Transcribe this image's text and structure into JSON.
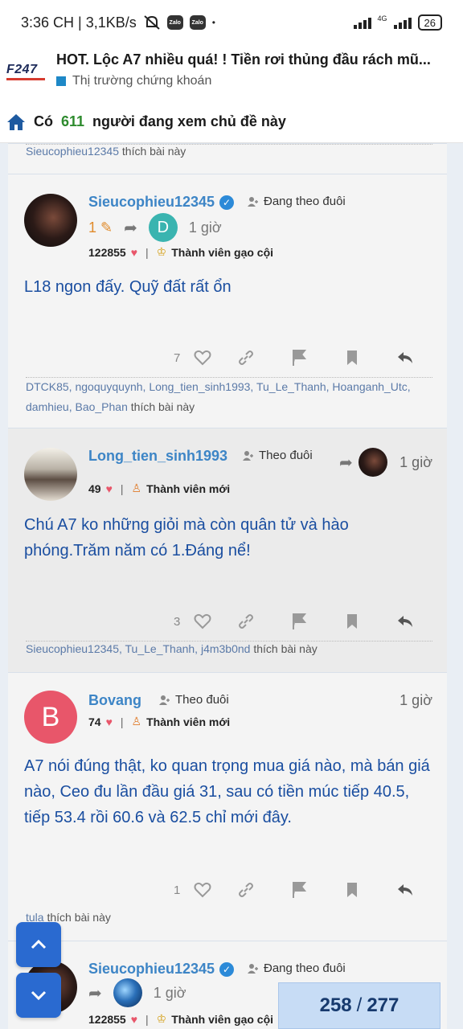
{
  "status": {
    "time": "3:36 CH | 3,1KB/s",
    "zalo1": "Zalo",
    "zalo2": "Zalo",
    "dot": "•",
    "network": "4G",
    "battery": "26"
  },
  "header": {
    "logo": "F247",
    "title": "HOT. Lộc A7 nhiều quá! ! Tiền rơi thủng đầu rách mũ...",
    "category": "Thị trường chứng khoán",
    "category_color": "#1e88c7"
  },
  "viewers": {
    "prefix": "Có",
    "count": "611",
    "suffix": "người đang xem chủ đề này"
  },
  "posts": [
    {
      "liked_names_top": "Sieucophieu12345",
      "liked_suffix_top": "thích bài này",
      "username": "Sieucophieu12345",
      "follow": "Đang theo đuôi",
      "edits": "1",
      "reply_avatar": "D",
      "time": "1 giờ",
      "points": "122855",
      "rank": "Thành viên gạo cội",
      "content": "L18 ngon đấy. Quỹ đất rất ổn",
      "likes": "7",
      "liked_names": "DTCK85, ngoquyquynh, Long_tien_sinh1993, Tu_Le_Thanh, Hoanganh_Utc, damhieu, Bao_Phan",
      "liked_suffix": "thích bài này"
    },
    {
      "username": "Long_tien_sinh1993",
      "follow": "Theo đuôi",
      "time": "1 giờ",
      "points": "49",
      "rank": "Thành viên mới",
      "content": "Chú A7 ko những giỏi mà còn quân tử và hào phóng.Trăm năm có 1.Đáng nể!",
      "likes": "3",
      "liked_names": "Sieucophieu12345, Tu_Le_Thanh, j4m3b0nd",
      "liked_suffix": "thích bài này"
    },
    {
      "avatar_letter": "B",
      "username": "Bovang",
      "follow": "Theo đuôi",
      "time": "1 giờ",
      "points": "74",
      "rank": "Thành viên mới",
      "content": "A7 nói đúng thật, ko quan trọng mua giá nào, mà bán giá nào, Ceo đu lần đầu giá 31, sau có tiền múc tiếp 40.5, tiếp 53.4 rồi 60.6 và 62.5 chỉ mới đây.",
      "likes": "1",
      "liked_names": "tula",
      "liked_suffix": "thích bài này"
    },
    {
      "username": "Sieucophieu12345",
      "follow": "Đang theo đuôi",
      "time": "1 giờ",
      "points": "122855",
      "rank": "Thành viên gạo cội"
    }
  ],
  "pager": {
    "current": "258",
    "total": "277"
  },
  "colors": {
    "username": "#3d85c6",
    "content": "#1a4ea0",
    "fab": "#2a6ad0",
    "heart": "#e8566a"
  }
}
